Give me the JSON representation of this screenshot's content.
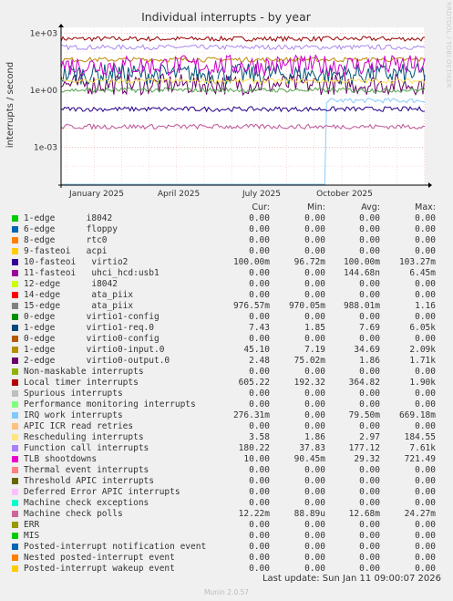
{
  "watermark": "RRDTOOL / TOBI OETIKER",
  "chart_data": {
    "type": "line",
    "title": "Individual interrupts - by year",
    "ylabel": "interrupts / second",
    "yscale": "log",
    "ylim": [
      1e-05,
      2000
    ],
    "ytick_labels": [
      "1e+03",
      "1e+00",
      "1e-03"
    ],
    "ytick_values": [
      1000,
      1,
      0.001
    ],
    "x_ticks": [
      "January 2025",
      "April 2025",
      "July 2025",
      "October 2025"
    ],
    "grid": true,
    "series": [
      {
        "name": "Local timer interrupts",
        "color": "#990000",
        "approx": 500
      },
      {
        "name": "Function call interrupts",
        "color": "#aa88ee",
        "approx": 180
      },
      {
        "name": "IRQ work interrupts",
        "color": "#88ccff",
        "approx": 0.28
      },
      {
        "name": "2-edge virtio0-output.0",
        "color": "#660066",
        "approx": 2
      },
      {
        "name": "1-edge virtio0-input.0",
        "color": "#bb8800",
        "approx": 40
      },
      {
        "name": "1-edge virtio1-req.0",
        "color": "#005577",
        "approx": 7
      },
      {
        "name": "10-fasteoi virtio2",
        "color": "#220088",
        "approx": 0.1
      },
      {
        "name": "TLB shootdowns",
        "color": "#cc00cc",
        "approx": 20
      },
      {
        "name": "Rescheduling interrupts",
        "color": "#ffdd55",
        "approx": 3
      },
      {
        "name": "15-edge ata_piix",
        "color": "#55aa55",
        "approx": 1
      },
      {
        "name": "Machine check polls",
        "color": "#bb5599",
        "approx": 0.012
      }
    ]
  },
  "legend": {
    "headers": [
      "Cur:",
      "Min:",
      "Avg:",
      "Max:"
    ],
    "rows": [
      {
        "label": "1-edge      i8042",
        "color": "#00cc00",
        "cur": "0.00",
        "min": "0.00",
        "avg": "0.00",
        "max": "0.00"
      },
      {
        "label": "6-edge      floppy",
        "color": "#0066b3",
        "cur": "0.00",
        "min": "0.00",
        "avg": "0.00",
        "max": "0.00"
      },
      {
        "label": "8-edge      rtc0",
        "color": "#ff8000",
        "cur": "0.00",
        "min": "0.00",
        "avg": "0.00",
        "max": "0.00"
      },
      {
        "label": "9-fasteoi   acpi",
        "color": "#ffcc00",
        "cur": "0.00",
        "min": "0.00",
        "avg": "0.00",
        "max": "0.00"
      },
      {
        "label": "10-fasteoi   virtio2",
        "color": "#330099",
        "cur": "100.00m",
        "min": "96.72m",
        "avg": "100.00m",
        "max": "103.27m"
      },
      {
        "label": "11-fasteoi   uhci_hcd:usb1",
        "color": "#990099",
        "cur": "0.00",
        "min": "0.00",
        "avg": "144.68n",
        "max": "6.45m"
      },
      {
        "label": "12-edge      i8042",
        "color": "#ccff00",
        "cur": "0.00",
        "min": "0.00",
        "avg": "0.00",
        "max": "0.00"
      },
      {
        "label": "14-edge      ata_piix",
        "color": "#ff0000",
        "cur": "0.00",
        "min": "0.00",
        "avg": "0.00",
        "max": "0.00"
      },
      {
        "label": "15-edge      ata_piix",
        "color": "#808080",
        "cur": "976.57m",
        "min": "970.05m",
        "avg": "988.01m",
        "max": "1.16"
      },
      {
        "label": "0-edge      virtio1-config",
        "color": "#008f00",
        "cur": "0.00",
        "min": "0.00",
        "avg": "0.00",
        "max": "0.00"
      },
      {
        "label": "1-edge      virtio1-req.0",
        "color": "#00487d",
        "cur": "7.43",
        "min": "1.85",
        "avg": "7.69",
        "max": "6.05k"
      },
      {
        "label": "0-edge      virtio0-config",
        "color": "#b35a00",
        "cur": "0.00",
        "min": "0.00",
        "avg": "0.00",
        "max": "0.00"
      },
      {
        "label": "1-edge      virtio0-input.0",
        "color": "#b38f00",
        "cur": "45.10",
        "min": "7.19",
        "avg": "34.69",
        "max": "2.09k"
      },
      {
        "label": "2-edge      virtio0-output.0",
        "color": "#6b006b",
        "cur": "2.48",
        "min": "75.02m",
        "avg": "1.86",
        "max": "1.71k"
      },
      {
        "label": "Non-maskable interrupts",
        "color": "#8fb300",
        "cur": "0.00",
        "min": "0.00",
        "avg": "0.00",
        "max": "0.00"
      },
      {
        "label": "Local timer interrupts",
        "color": "#b30000",
        "cur": "605.22",
        "min": "192.32",
        "avg": "364.82",
        "max": "1.90k"
      },
      {
        "label": "Spurious interrupts",
        "color": "#bebebe",
        "cur": "0.00",
        "min": "0.00",
        "avg": "0.00",
        "max": "0.00"
      },
      {
        "label": "Performance monitoring interrupts",
        "color": "#80ff80",
        "cur": "0.00",
        "min": "0.00",
        "avg": "0.00",
        "max": "0.00"
      },
      {
        "label": "IRQ work interrupts",
        "color": "#80c9ff",
        "cur": "276.31m",
        "min": "0.00",
        "avg": "79.50m",
        "max": "669.18m"
      },
      {
        "label": "APIC ICR read retries",
        "color": "#ffc080",
        "cur": "0.00",
        "min": "0.00",
        "avg": "0.00",
        "max": "0.00"
      },
      {
        "label": "Rescheduling interrupts",
        "color": "#ffe680",
        "cur": "3.58",
        "min": "1.86",
        "avg": "2.97",
        "max": "184.55"
      },
      {
        "label": "Function call interrupts",
        "color": "#aa80ff",
        "cur": "180.22",
        "min": "37.83",
        "avg": "177.12",
        "max": "7.61k"
      },
      {
        "label": "TLB shootdowns",
        "color": "#ee00cc",
        "cur": "10.00",
        "min": "90.45m",
        "avg": "29.32",
        "max": "721.49"
      },
      {
        "label": "Thermal event interrupts",
        "color": "#ff8080",
        "cur": "0.00",
        "min": "0.00",
        "avg": "0.00",
        "max": "0.00"
      },
      {
        "label": "Threshold APIC interrupts",
        "color": "#666600",
        "cur": "0.00",
        "min": "0.00",
        "avg": "0.00",
        "max": "0.00"
      },
      {
        "label": "Deferred Error APIC interrupts",
        "color": "#ffbfff",
        "cur": "0.00",
        "min": "0.00",
        "avg": "0.00",
        "max": "0.00"
      },
      {
        "label": "Machine check exceptions",
        "color": "#00ffcc",
        "cur": "0.00",
        "min": "0.00",
        "avg": "0.00",
        "max": "0.00"
      },
      {
        "label": "Machine check polls",
        "color": "#cc6699",
        "cur": "12.22m",
        "min": "88.89u",
        "avg": "12.68m",
        "max": "24.27m"
      },
      {
        "label": "ERR",
        "color": "#999900",
        "cur": "0.00",
        "min": "0.00",
        "avg": "0.00",
        "max": "0.00"
      },
      {
        "label": "MIS",
        "color": "#00cc00",
        "cur": "0.00",
        "min": "0.00",
        "avg": "0.00",
        "max": "0.00"
      },
      {
        "label": "Posted-interrupt notification event",
        "color": "#0066b3",
        "cur": "0.00",
        "min": "0.00",
        "avg": "0.00",
        "max": "0.00"
      },
      {
        "label": "Nested posted-interrupt event",
        "color": "#ff8000",
        "cur": "0.00",
        "min": "0.00",
        "avg": "0.00",
        "max": "0.00"
      },
      {
        "label": "Posted-interrupt wakeup event",
        "color": "#ffcc00",
        "cur": "0.00",
        "min": "0.00",
        "avg": "0.00",
        "max": "0.00"
      }
    ]
  },
  "footer": {
    "last_update": "Last update: Sun Jan 11 09:00:07 2026",
    "version": "Munin 2.0.57"
  }
}
